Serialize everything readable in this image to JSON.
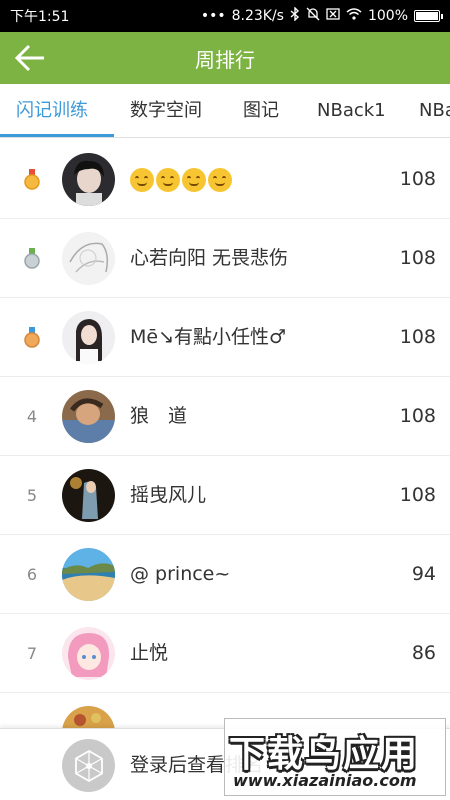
{
  "status_bar": {
    "time": "下午1:51",
    "network_speed": "8.23K/s",
    "battery": "100%"
  },
  "header": {
    "title": "周排行",
    "accent": "#7cb342"
  },
  "tabs": [
    {
      "label": "闪记训练",
      "active": true
    },
    {
      "label": "数字空间",
      "active": false
    },
    {
      "label": "图记",
      "active": false
    },
    {
      "label": "NBack1",
      "active": false
    },
    {
      "label": "NBa",
      "active": false
    }
  ],
  "tab_accent": "#3d9ad9",
  "rankings": [
    {
      "rank": "",
      "medal": "gold",
      "name": "",
      "name_icons": [
        "smirk-emoji",
        "squint-tongue-emoji",
        "wink-tongue-emoji",
        "eye-roll-emoji"
      ],
      "score": "108"
    },
    {
      "rank": "",
      "medal": "silver",
      "name": "心若向阳 无畏悲伤",
      "score": "108"
    },
    {
      "rank": "",
      "medal": "bronze",
      "name": "Mē↘有點小任性♂",
      "score": "108"
    },
    {
      "rank": "4",
      "name": "狼　道",
      "score": "108"
    },
    {
      "rank": "5",
      "name": "摇曳风儿",
      "score": "108"
    },
    {
      "rank": "6",
      "name": "@ prince~",
      "score": "94"
    },
    {
      "rank": "7",
      "name": "止悦",
      "score": "86"
    }
  ],
  "bottom": {
    "login_prompt": "登录后查看排名"
  },
  "watermark": {
    "logo": "下载鸟应用",
    "url": "www.xiazainiao.com"
  }
}
